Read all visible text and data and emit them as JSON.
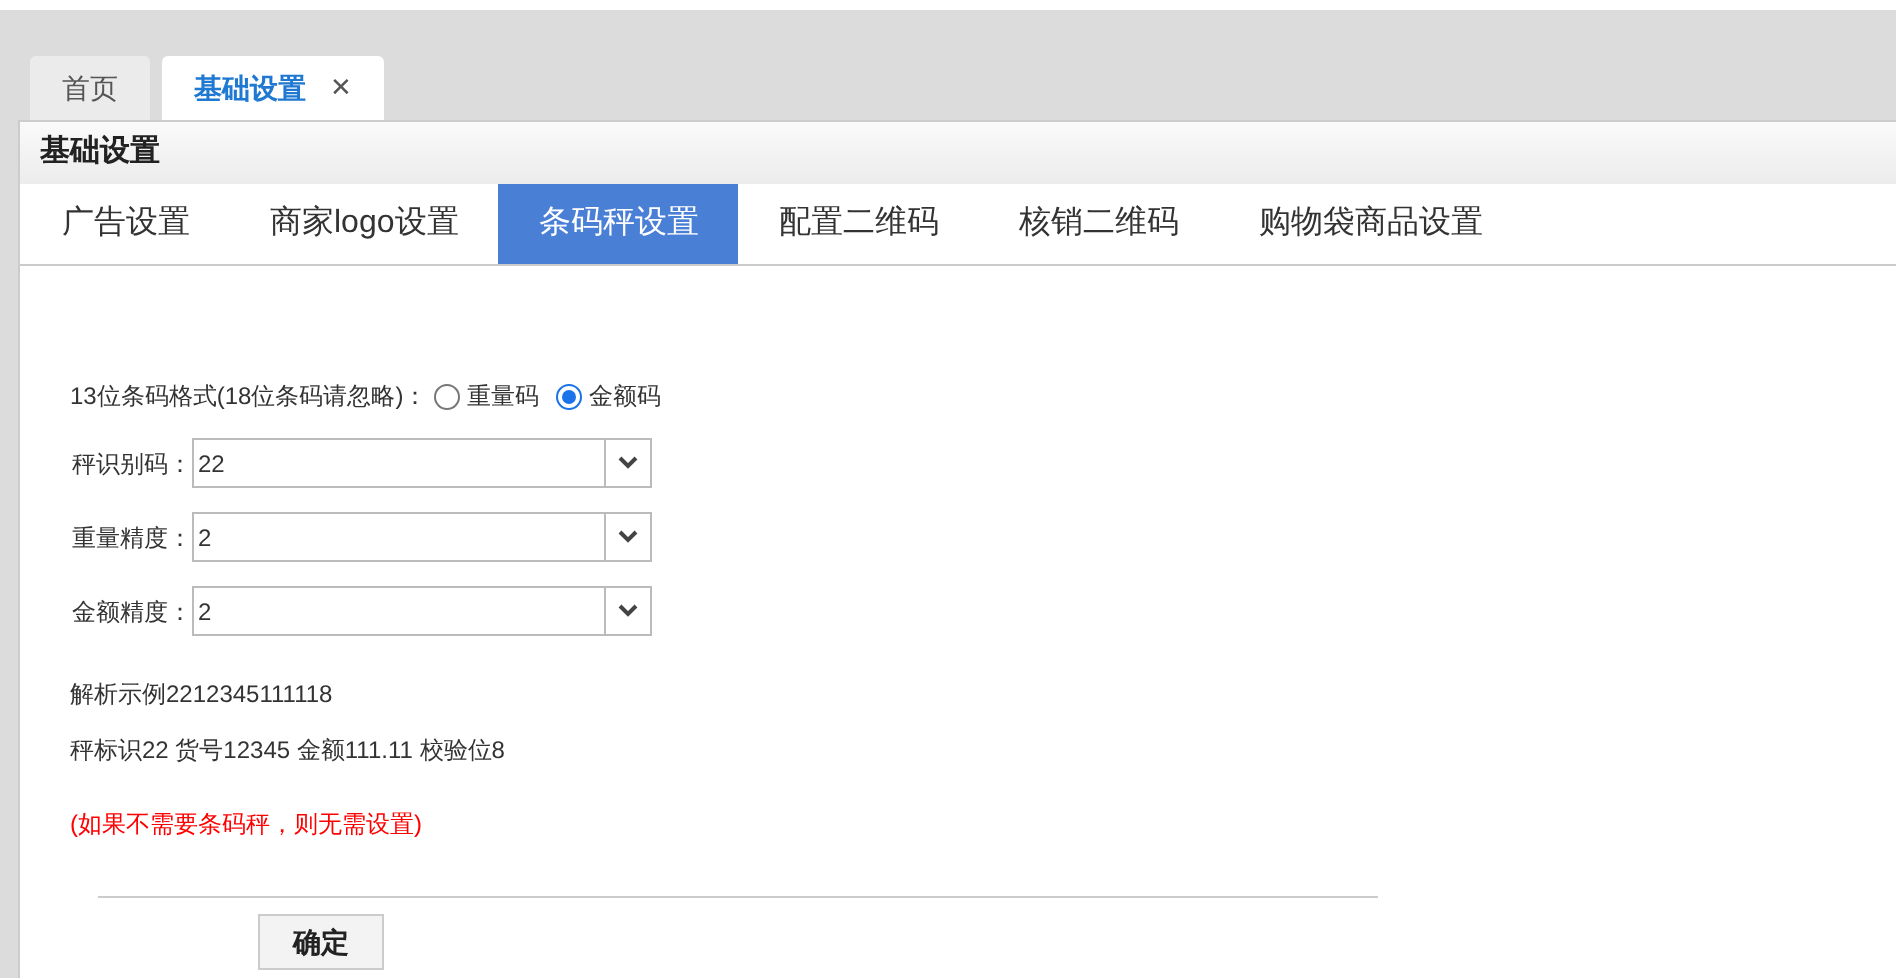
{
  "page_tabs": [
    {
      "label": "首页",
      "selected": false
    },
    {
      "label": "基础设置",
      "selected": true,
      "close": "✕"
    }
  ],
  "panel": {
    "title": "基础设置"
  },
  "tabs": [
    {
      "label": "广告设置",
      "selected": false
    },
    {
      "label": "商家logo设置",
      "selected": false
    },
    {
      "label": "条码秤设置",
      "selected": true
    },
    {
      "label": "配置二维码",
      "selected": false
    },
    {
      "label": "核销二维码",
      "selected": false
    },
    {
      "label": "购物袋商品设置",
      "selected": false
    }
  ],
  "format": {
    "label": "13位条码格式(18位条码请忽略)：",
    "options": [
      {
        "label": "重量码",
        "selected": false
      },
      {
        "label": "金额码",
        "selected": true
      }
    ]
  },
  "fields": [
    {
      "label": "秤识别码：",
      "value": "22"
    },
    {
      "label": "重量精度：",
      "value": "2"
    },
    {
      "label": "金额精度：",
      "value": "2"
    }
  ],
  "example": "解析示例2212345111118",
  "example_detail": "秤标识22 货号12345 金额111.11 校验位8",
  "note": "(如果不需要条码秤，则无需设置)",
  "confirm_button": "确定"
}
